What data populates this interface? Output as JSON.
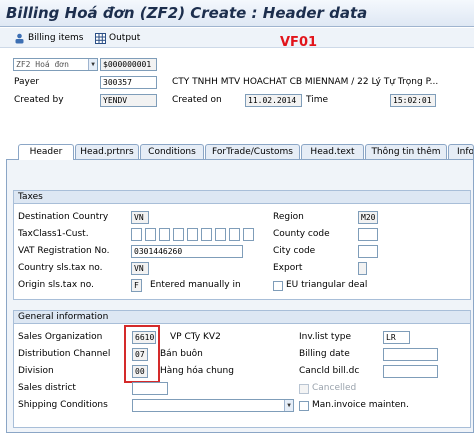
{
  "title": "Billing Hoá đơn  (ZF2) Create : Header data",
  "toolbar": {
    "billing_items": "Billing items",
    "output": "Output"
  },
  "transaction_code": "VF01",
  "header": {
    "doc_type": "ZF2 Hoá đơn",
    "doc_number": "$000000001",
    "payer_label": "Payer",
    "payer_value": "300357",
    "payer_name": "CTY TNHH MTV HOACHAT CB MIENNAM / 22 Lý Tự Trọng P...",
    "created_by_label": "Created by",
    "created_by_value": "YENDV",
    "created_on_label": "Created on",
    "created_on_value": "11.02.2014",
    "time_label": "Time",
    "time_value": "15:02:01"
  },
  "tabs": [
    {
      "label": "Header",
      "active": true
    },
    {
      "label": "Head.prtnrs",
      "active": false
    },
    {
      "label": "Conditions",
      "active": false
    },
    {
      "label": "ForTrade/Customs",
      "active": false
    },
    {
      "label": "Head.text",
      "active": false
    },
    {
      "label": "Thông tin thêm",
      "active": false
    },
    {
      "label": "Info",
      "active": false
    }
  ],
  "taxes": {
    "title": "Taxes",
    "destination_country_label": "Destination Country",
    "destination_country_value": "VN",
    "taxclass_label": "TaxClass1-Cust.",
    "vat_label": "VAT Registration No.",
    "vat_value": "0301446260",
    "country_sls_label": "Country sls.tax no.",
    "country_sls_value": "VN",
    "origin_label": "Origin sls.tax no.",
    "origin_value": "F",
    "origin_text": "Entered manually in",
    "region_label": "Region",
    "region_value": "M20",
    "county_label": "County code",
    "city_label": "City code",
    "export_label": "Export",
    "eu_label": "EU triangular deal"
  },
  "general": {
    "title": "General information",
    "sales_org_label": "Sales Organization",
    "sales_org_value": "6610",
    "sales_org_text": "VP CTy KV2",
    "dist_channel_label": "Distribution Channel",
    "dist_channel_value": "07",
    "dist_channel_text": "Bán buôn",
    "division_label": "Division",
    "division_value": "00",
    "division_text": "Hàng hóa chung",
    "sales_district_label": "Sales district",
    "shipping_label": "Shipping Conditions",
    "inv_list_label": "Inv.list type",
    "inv_list_value": "LR",
    "billing_date_label": "Billing date",
    "cancld_label": "Cancld bill.dc",
    "cancelled_label": "Cancelled",
    "man_invoice_label": "Man.invoice mainten."
  }
}
